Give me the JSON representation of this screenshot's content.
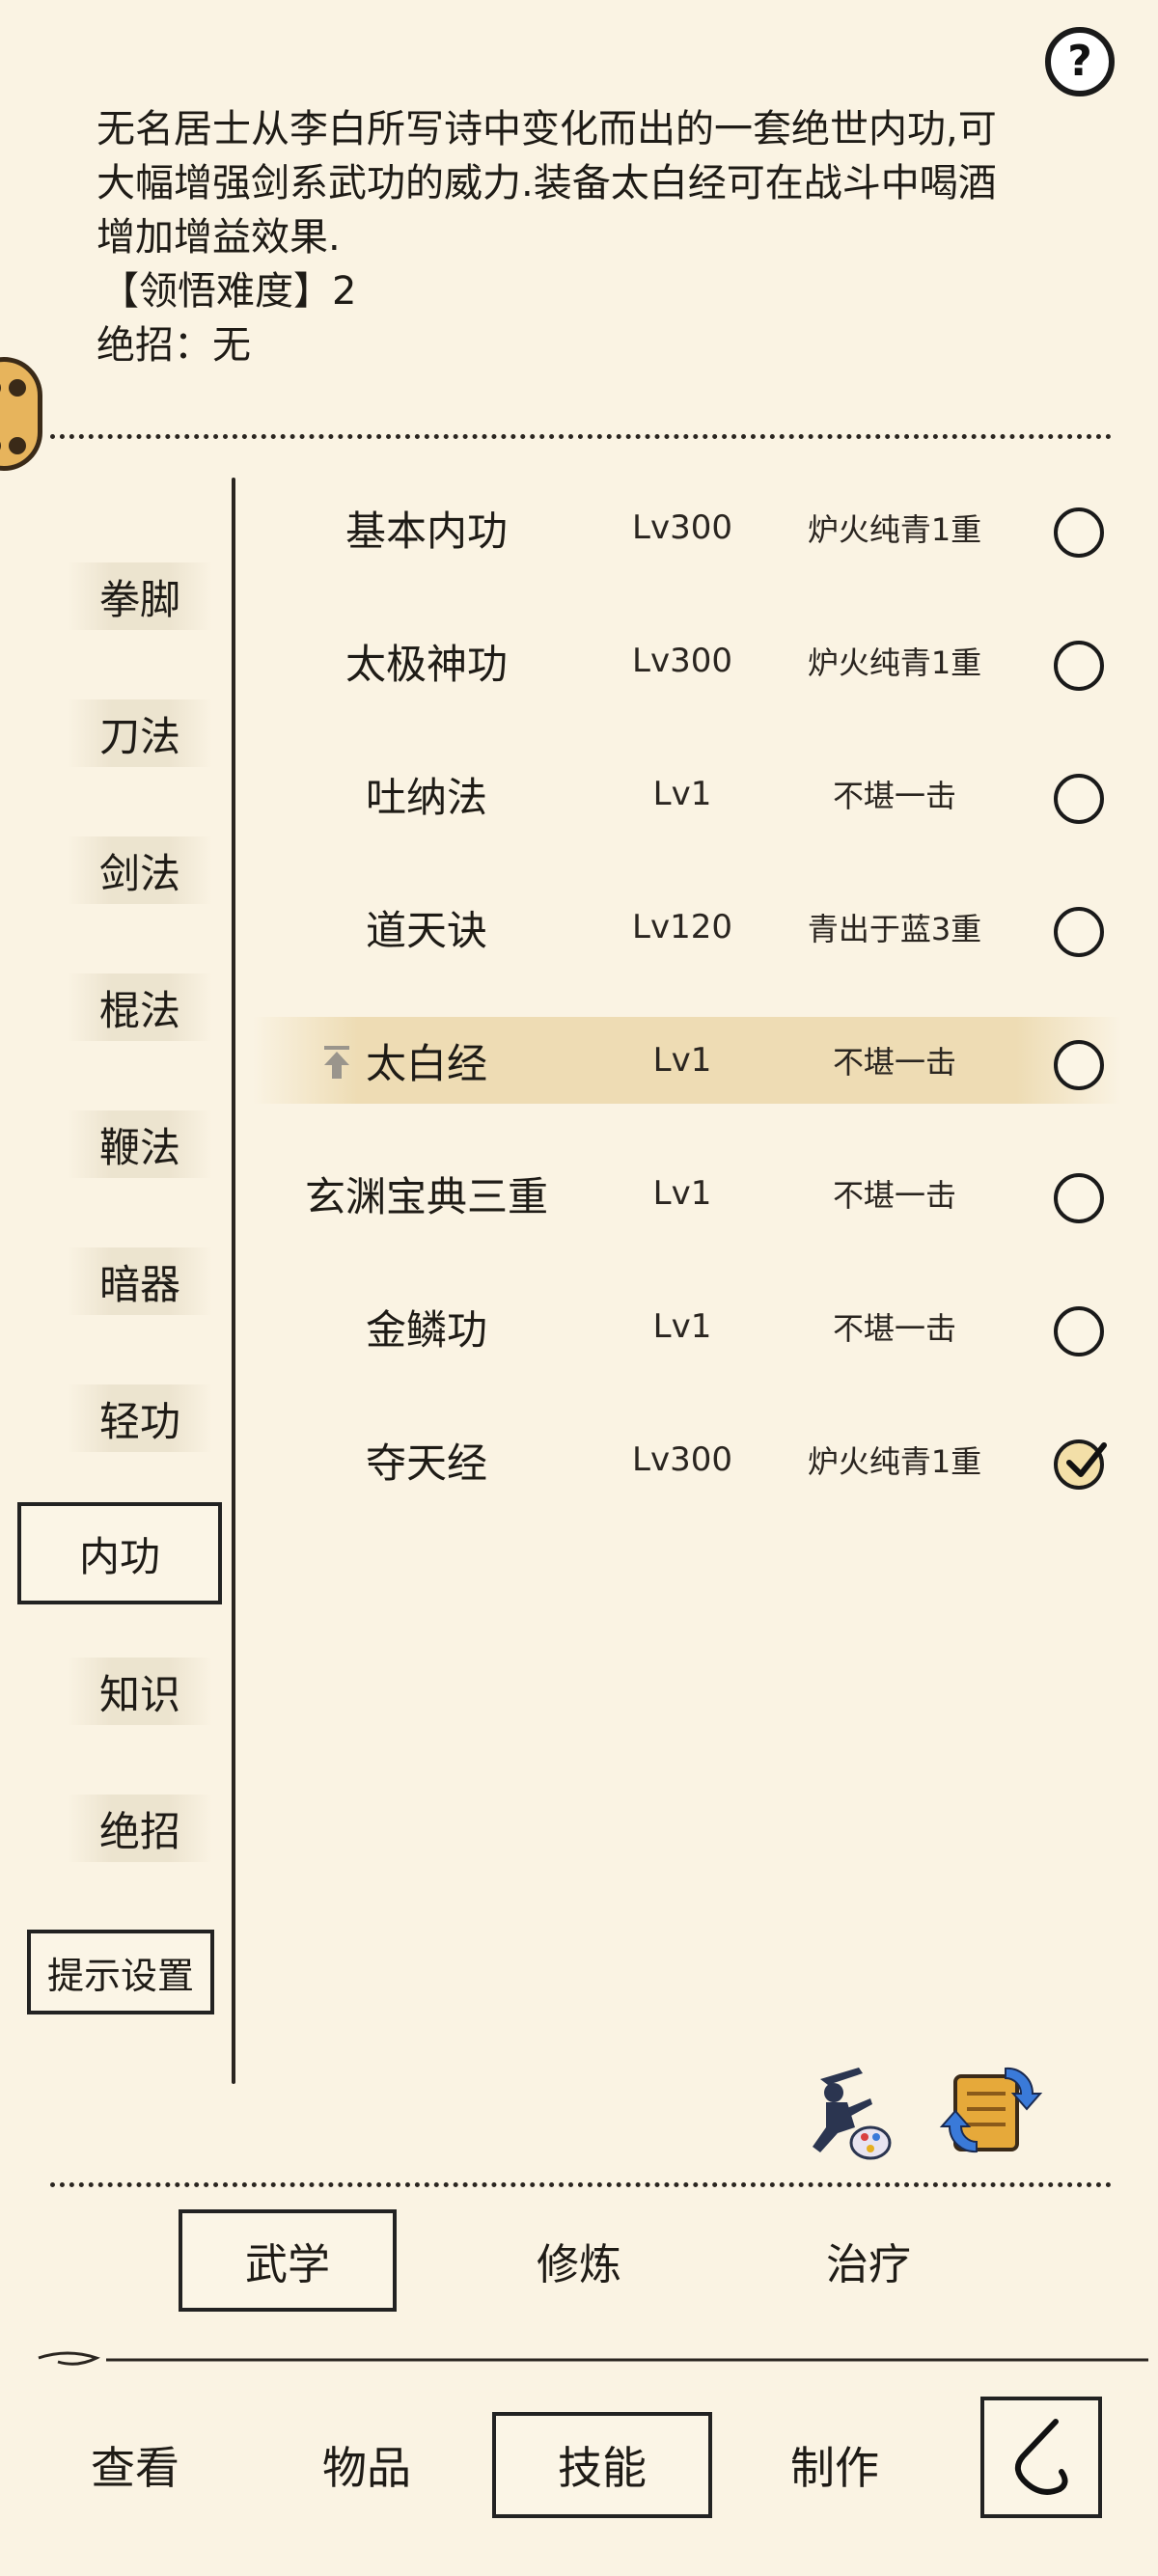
{
  "description": {
    "lines": [
      "无名居士从李白所写诗中变化而出的一套绝世内功,可",
      "大幅增强剑系武功的威力.装备太白经可在战斗中喝酒",
      "增加增益效果."
    ],
    "difficulty": "【领悟难度】2",
    "ultimate": "绝招：无"
  },
  "help_label": "?",
  "categories": [
    "拳脚",
    "刀法",
    "剑法",
    "棍法",
    "鞭法",
    "暗器",
    "轻功",
    "内功",
    "知识",
    "绝招"
  ],
  "active_category": "内功",
  "hint_settings": "提示设置",
  "skills": [
    {
      "name": "基本内功",
      "level": "Lv300",
      "rank": "炉火纯青1重",
      "equipped": false
    },
    {
      "name": "太极神功",
      "level": "Lv300",
      "rank": "炉火纯青1重",
      "equipped": false
    },
    {
      "name": "吐纳法",
      "level": "Lv1",
      "rank": "不堪一击",
      "equipped": false
    },
    {
      "name": "道天诀",
      "level": "Lv120",
      "rank": "青出于蓝3重",
      "equipped": false
    },
    {
      "name": "太白经",
      "level": "Lv1",
      "rank": "不堪一击",
      "equipped": false,
      "selected": true
    },
    {
      "name": "玄渊宝典三重",
      "level": "Lv1",
      "rank": "不堪一击",
      "equipped": false
    },
    {
      "name": "金鳞功",
      "level": "Lv1",
      "rank": "不堪一击",
      "equipped": false
    },
    {
      "name": "夺天经",
      "level": "Lv300",
      "rank": "炉火纯青1重",
      "equipped": true
    }
  ],
  "sub_tabs": [
    "武学",
    "修炼",
    "治疗"
  ],
  "active_sub_tab": "武学",
  "nav": [
    "查看",
    "物品",
    "技能",
    "制作"
  ],
  "active_nav": "技能",
  "icons": {
    "help": "question-icon",
    "float": "dice-icon",
    "pin": "pin-up-icon",
    "martial": "swordsman-palette-icon",
    "swap": "scroll-swap-icon",
    "back": "back-arrow-icon"
  },
  "colors": {
    "background": "#faf3e3",
    "highlight": "#edd6ae",
    "ink": "#1e1b16"
  }
}
